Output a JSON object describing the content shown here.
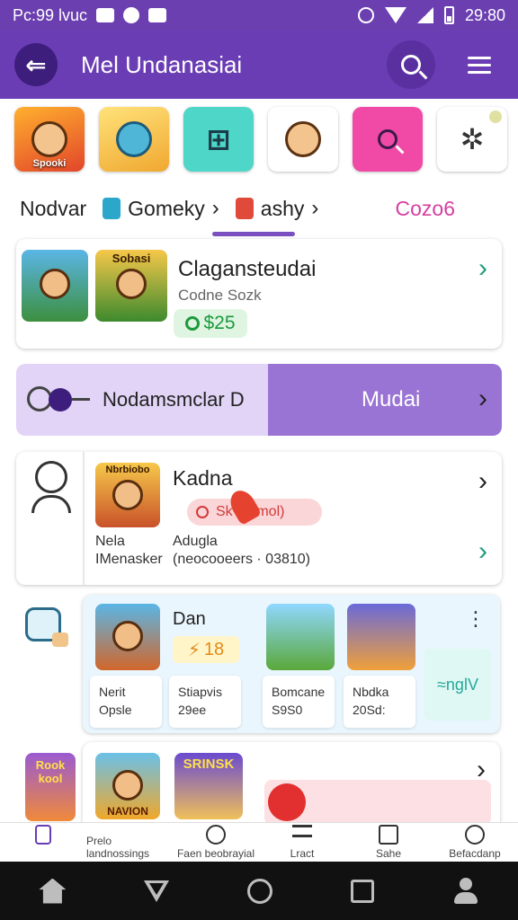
{
  "status_bar": {
    "time_left": "Pc:99 lvuc",
    "time_right": "29:80"
  },
  "app_bar": {
    "back_glyph": "⇐",
    "title": "Mel Undanasiai"
  },
  "tiles": [
    {
      "label": "Spooki",
      "icon": "character-icon"
    },
    {
      "label": "",
      "icon": "robot-icon"
    },
    {
      "label": "",
      "icon": "blocks-icon"
    },
    {
      "label": "",
      "icon": "mascot-icon"
    },
    {
      "label": "",
      "icon": "magnifier-icon"
    },
    {
      "label": "",
      "icon": "gear-icon"
    }
  ],
  "tabs": {
    "t1": "Nodvar",
    "t2": "Gomeky",
    "t3": "ashy",
    "t4": "Cozo6"
  },
  "card1": {
    "thumb2_label": "Sobasi",
    "title": "Clagansteudai",
    "subtitle": "Codne Sozk",
    "price": "$25"
  },
  "banner": {
    "text": "Nodamsmclar D",
    "action": "Mudai"
  },
  "card2": {
    "thumb_label": "Nbrbiobo",
    "title": "Kadna",
    "pill": "Sk Mamol)",
    "left_line1": "Nela",
    "left_line2": "IMenasker",
    "right_line1": "Adugla",
    "right_line2": "(neocooeers · 03810)"
  },
  "card3": {
    "title": "Dan",
    "badge": "18",
    "mini1_l1": "Nerit",
    "mini1_l2": "Opsle",
    "mini2_l1": "Stiapvis",
    "mini2_l2": "29ee",
    "mini3_l1": "Bomcane",
    "mini3_l2": "S9S0",
    "mini4_l1": "Nbdka",
    "mini4_l2": "20Sd:",
    "side_text": "≈nglV",
    "more": "⋮"
  },
  "card4": {
    "thumb_a": "Rook kool",
    "thumb_b": "NAVION",
    "thumb_c": "SRINSK"
  },
  "bottom_nav": [
    {
      "label": "",
      "icon": "hourglass-icon"
    },
    {
      "label": "Prelo landnossings"
    },
    {
      "label": "Faen beobrayial"
    },
    {
      "label": "Lract"
    },
    {
      "label": "Sahe"
    },
    {
      "label": "Befacdanp"
    }
  ],
  "colors": {
    "primary": "#6a3db4",
    "accent_pink": "#d63fa0",
    "teal": "#1f9b7d"
  }
}
